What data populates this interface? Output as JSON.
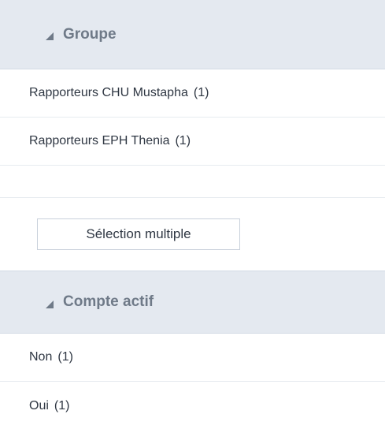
{
  "sections": {
    "groupe": {
      "title": "Groupe",
      "items": [
        {
          "label": "Rapporteurs CHU Mustapha",
          "count": "(1)"
        },
        {
          "label": "Rapporteurs EPH Thenia",
          "count": "(1)"
        }
      ],
      "multi_select_label": "Sélection multiple"
    },
    "compte_actif": {
      "title": "Compte actif",
      "items": [
        {
          "label": "Non",
          "count": "(1)"
        },
        {
          "label": "Oui",
          "count": "(1)"
        }
      ]
    }
  },
  "colors": {
    "header_bg": "#e4e9f0",
    "header_text": "#6f7a88",
    "item_text": "#2f3743",
    "divider": "#e7ebf0",
    "button_border": "#c9d1db"
  },
  "icons": {
    "collapse": "triangle-collapse-icon"
  }
}
